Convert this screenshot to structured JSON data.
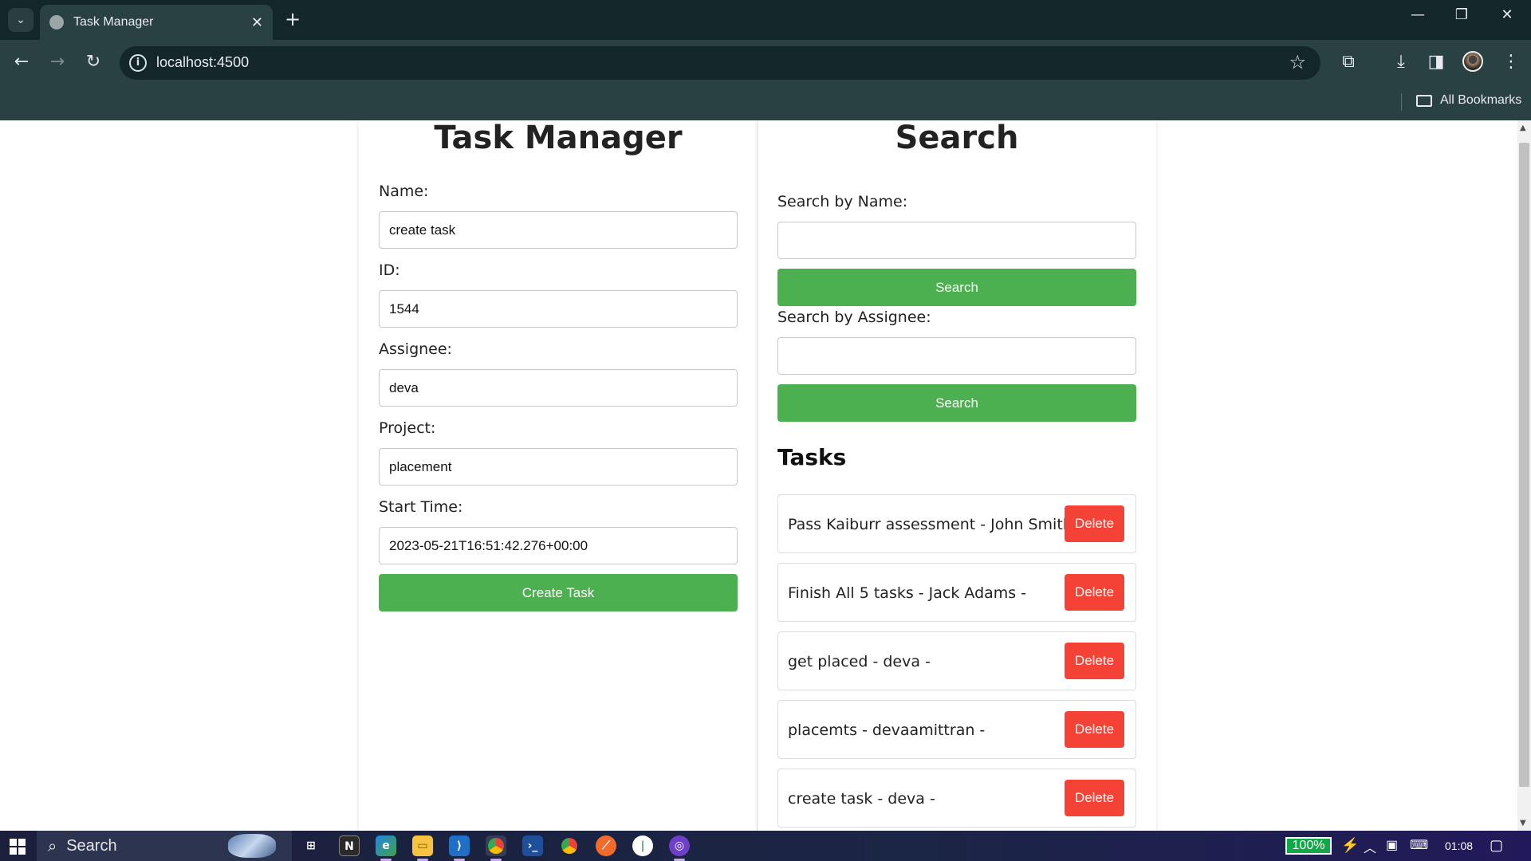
{
  "browser": {
    "tab_title": "Task Manager",
    "tab_close": "✕",
    "new_tab": "+",
    "url": "localhost:4500",
    "bookmarks_label": "All Bookmarks"
  },
  "left": {
    "heading": "Task Manager",
    "fields": [
      {
        "label": "Name:",
        "value": "create task"
      },
      {
        "label": "ID:",
        "value": "1544"
      },
      {
        "label": "Assignee:",
        "value": "deva"
      },
      {
        "label": "Project:",
        "value": "placement"
      },
      {
        "label": "Start Time:",
        "value": "2023-05-21T16:51:42.276+00:00"
      }
    ],
    "create_button": "Create Task"
  },
  "right": {
    "heading": "Search",
    "search_name_label": "Search by Name:",
    "search_name_value": "",
    "search_assignee_label": "Search by Assignee:",
    "search_assignee_value": "",
    "search_button": "Search",
    "tasks_heading": "Tasks",
    "delete_label": "Delete",
    "tasks": [
      "Pass Kaiburr assessment - John Smith -",
      "Finish All 5 tasks - Jack Adams -",
      "get placed - deva -",
      "placemts - devaamittran -",
      "create task - deva -"
    ]
  },
  "taskbar": {
    "search_text": "Search",
    "battery": "100%",
    "time": "01:08"
  },
  "colors": {
    "green": "#4caf50",
    "red": "#f44336",
    "chrome": "#2a4144"
  }
}
